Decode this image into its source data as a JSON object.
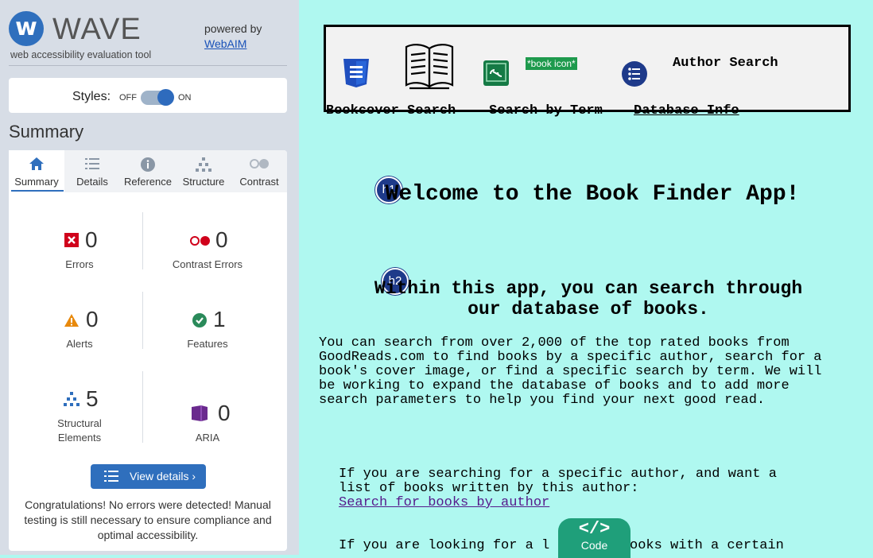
{
  "sidebar": {
    "logo_text": "WAVE",
    "logo_subtitle": "web accessibility evaluation tool",
    "powered_by": "powered by",
    "webaim_link": "WebAIM",
    "styles_label": "Styles:",
    "styles_off": "OFF",
    "styles_on": "ON",
    "styles_state": "on",
    "summary_heading": "Summary",
    "tabs": [
      {
        "label": "Summary",
        "icon": "home-icon",
        "active": true
      },
      {
        "label": "Details",
        "icon": "list-icon",
        "active": false
      },
      {
        "label": "Reference",
        "icon": "info-icon",
        "active": false
      },
      {
        "label": "Structure",
        "icon": "structure-icon",
        "active": false
      },
      {
        "label": "Contrast",
        "icon": "contrast-icon",
        "active": false
      }
    ],
    "stats": {
      "errors": {
        "count": "0",
        "label": "Errors",
        "color": "#d0021b"
      },
      "contrast_errors": {
        "count": "0",
        "label": "Contrast Errors",
        "color": "#d0021b"
      },
      "alerts": {
        "count": "0",
        "label": "Alerts",
        "color": "#e8890c"
      },
      "features": {
        "count": "1",
        "label": "Features",
        "color": "#2a8a5a"
      },
      "structural": {
        "count": "5",
        "label1": "Structural",
        "label2": "Elements",
        "color": "#2f6fbd"
      },
      "aria": {
        "count": "0",
        "label": "ARIA",
        "color": "#6a2a8e"
      }
    },
    "view_details": "View details ›",
    "congrats": "Congratulations! No errors were detected! Manual testing is still necessary to ensure compliance and optimal accessibility."
  },
  "main": {
    "nav": {
      "book_icon_alt": "*book icon*",
      "author_search": "Author Search",
      "bookcover_search": "Bookcover Search",
      "search_by_term": "Search by Term",
      "database_info": "Database Info"
    },
    "h1_badge": "h1",
    "h1": "Welcome to the Book Finder App!",
    "h2_badge": "h2",
    "h2": "Within this app, you can search through our database of books.",
    "intro": "You can search from over 2,000 of the top rated books from\nGoodReads.com to find books by a specific author, search for a\nbook's cover image, or find a specific search by term. We will\nbe working to expand the database of books and to add more\nsearch parameters to help you find your next good read.",
    "author_para": "If you are searching for a specific author, and want a\nlist of books written by this author:",
    "author_link": "Search for books by author",
    "looking_para": "If you are looking for a l",
    "looking_para_rest": "ooks with a certain",
    "code_button": "Code",
    "code_icon": "</>"
  },
  "colors": {
    "page_bg": "#aff8f0",
    "sidebar_bg": "#d7dde6",
    "accent": "#2f6fbd",
    "code_button": "#1f9f7a"
  }
}
